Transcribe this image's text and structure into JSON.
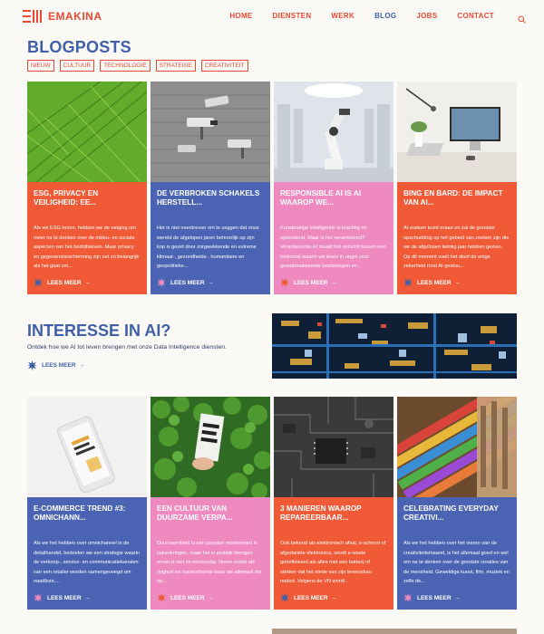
{
  "brand": {
    "name": "EMAKINA",
    "accent": "#e84a34",
    "blue": "#3f5fa8"
  },
  "nav": {
    "items": [
      "HOME",
      "DIENSTEN",
      "WERK",
      "BLOG",
      "JOBS",
      "CONTACT"
    ],
    "active": "BLOG",
    "search_icon": "search-icon"
  },
  "blog": {
    "title": "BLOGPOSTS",
    "tags": [
      "NIEUW",
      "CULTUUR",
      "TECHNOLOGIE",
      "STRATEGIE",
      "CREATIVITEIT"
    ]
  },
  "cards_row1": [
    {
      "title": "ESG, PRIVACY EN VEILIGHEID: EE...",
      "desc": "Als we ESG horen, hebben we de neiging om meer na te denken over de milieu- en sociale aspecten van het bedrijfsleven. Maar privacy en gegevensbescherming zijn net zo belangrijk als het gaat om...",
      "more": "LEES MEER",
      "color": "orange",
      "image": "green-leaf"
    },
    {
      "title": "DE VERBROKEN SCHAKELS HERSTELL...",
      "desc": "Het is niet overdreven om te zeggen dat onze wereld de afgelopen jaren behoorlijk op zijn kop is gezet door zorgwekkende en extreme klimaat-, gezondheids-, humanitaire en geopolitieke...",
      "more": "LEES MEER",
      "color": "blue",
      "image": "security-cameras"
    },
    {
      "title": "RESPONSIBLE AI IS AI WAAROP WE...",
      "desc": "Kunstmatige Intelligentie is krachtig en opwindend. Maar is het verantwoord? Verantwoorde AI maakt het verschil tussen een toekomst waarin we leven in angst voor geautomatiseerde beslissingen en...",
      "more": "LEES MEER",
      "color": "pink",
      "image": "robot-arm"
    },
    {
      "title": "BING EN BARD: DE IMPACT VAN AI...",
      "desc": "AI-zoeken komt eraan en zal de grootste opschudding op het gebied van zoeken zijn die we de afgelopen twintig jaar hebben gezien. Op dit moment voelt het alsof de enige zekerheid rond AI-gestuu...",
      "more": "LEES MEER",
      "color": "orange",
      "image": "desk-laptop"
    }
  ],
  "ai": {
    "title": "INTERESSE IN AI?",
    "subtitle": "Ontdek hoe we AI tot leven brengen met onze Data Intelligence diensten.",
    "more": "LEES MEER",
    "image": "circuit-board"
  },
  "cards_row2": [
    {
      "title": "E-COMMERCE TREND #3: OMNICHANN...",
      "desc": "Als we het hebben over omnichannel in de detailhandel, bedoelen we een strategie waarin de verkoop-, service- en communicatiekanalen van een retailer worden samengevoegd om naadloze,...",
      "more": "LEES MEER",
      "color": "blue",
      "image": "phone-mockup"
    },
    {
      "title": "EEN CULTUUR VAN DUURZAME VERPA...",
      "desc": "Duurzaamheid is een populair modewoord in zakenkringen, maar het in praktijk brengen ervan is niet zo eenvoudig. Neem zoiets als yoghurt en tussendoortje waar we allemaal dol op...",
      "more": "LEES MEER",
      "color": "pink",
      "image": "carton-greens"
    },
    {
      "title": "3 MANIEREN WAAROP REPAREERBAAR...",
      "desc": "Ook bekend als elektronisch afval, e-schroot of afgedankte elektronica, wordt e-waste gedefinieerd als alles met een batterij of stekker dat het einde van zijn levensduur nadert. Volgens de VN wordt...",
      "more": "LEES MEER",
      "color": "orange",
      "image": "circuit-chip"
    },
    {
      "title": "CELEBRATING EVERYDAY CREATIVI...",
      "desc": "Als we het hebben over het vieren van de creativiteitsmaand, is het allemaal goed en wel om na te denken over de grootste creaties van de mensheid. Geweldige kunst, film, muziek en zelfs de...",
      "more": "LEES MEER",
      "color": "blue",
      "image": "paint-brushes"
    }
  ]
}
